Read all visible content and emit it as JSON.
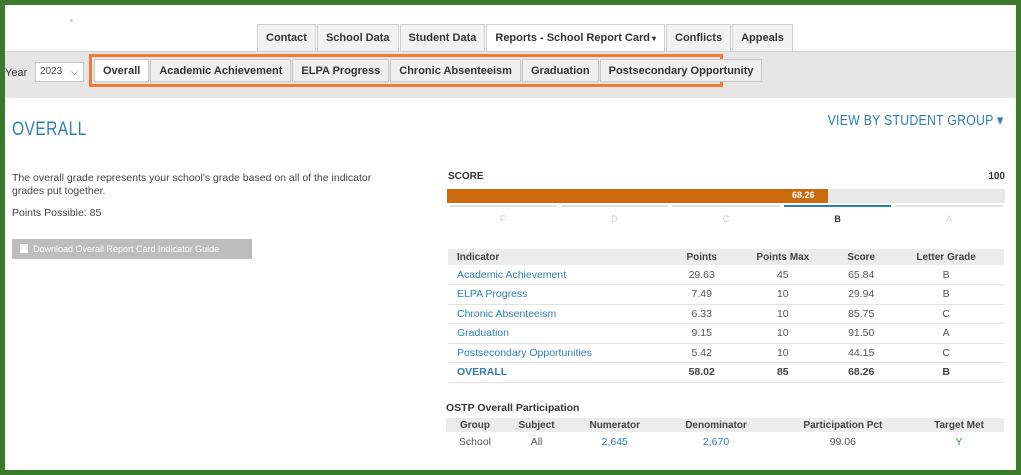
{
  "top_tabs": [
    {
      "label": "Contact"
    },
    {
      "label": "School Data"
    },
    {
      "label": "Student Data"
    },
    {
      "label": "Reports - School Report Card"
    },
    {
      "label": "Conflicts"
    },
    {
      "label": "Appeals"
    }
  ],
  "year": {
    "label": "Year",
    "value": "2023"
  },
  "sub_tabs": [
    {
      "label": "Overall"
    },
    {
      "label": "Academic Achievement"
    },
    {
      "label": "ELPA Progress"
    },
    {
      "label": "Chronic Absenteeism"
    },
    {
      "label": "Graduation"
    },
    {
      "label": "Postsecondary Opportunity"
    }
  ],
  "main": {
    "title": "OVERALL",
    "view_by": "VIEW BY STUDENT GROUP",
    "description": "The overall grade represents your school's grade based on all of the indicator grades put together.",
    "points_possible": "Points Possible: 85",
    "download_label": "Download Overall Report Card Indicator Guide"
  },
  "score": {
    "label": "SCORE",
    "max_label": "100",
    "value": 68.26,
    "value_label": "68.26",
    "grades": [
      "F",
      "D",
      "C",
      "B",
      "A"
    ],
    "active_grade": "B"
  },
  "indicator_table": {
    "headers": [
      "Indicator",
      "Points",
      "Points Max",
      "Score",
      "Letter Grade"
    ],
    "rows": [
      [
        "Academic Achievement",
        "29.63",
        "45",
        "65.84",
        "B"
      ],
      [
        "ELPA Progress",
        "7.49",
        "10",
        "29.94",
        "B"
      ],
      [
        "Chronic Absenteeism",
        "6.33",
        "10",
        "85.75",
        "C"
      ],
      [
        "Graduation",
        "9.15",
        "10",
        "91.50",
        "A"
      ],
      [
        "Postsecondary Opportunities",
        "5.42",
        "10",
        "44.15",
        "C"
      ]
    ],
    "total": [
      "OVERALL",
      "58.02",
      "85",
      "68.26",
      "B"
    ]
  },
  "participation": {
    "title": "OSTP Overall Participation",
    "headers": [
      "Group",
      "Subject",
      "Numerator",
      "Denominator",
      "Participation Pct",
      "Target Met"
    ],
    "row": [
      "School",
      "All",
      "2,645",
      "2,670",
      "99.06",
      "Y"
    ]
  },
  "colors": {
    "brand_blue": "#2e7fb0",
    "highlight_orange": "#f27a33",
    "score_bar": "#cc6a10",
    "frame_green": "#3a7a2a"
  }
}
